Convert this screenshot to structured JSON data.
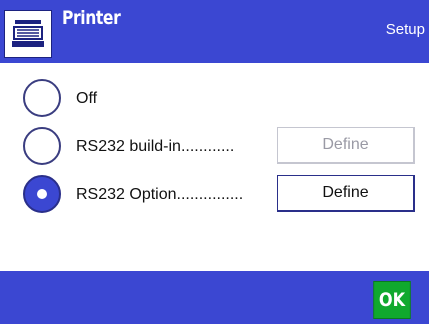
{
  "header": {
    "title": "Printer",
    "section": "Setup",
    "icon": "printer-icon"
  },
  "options": [
    {
      "label": "Off",
      "selected": false,
      "has_define": false
    },
    {
      "label": "RS232 build-in............",
      "selected": false,
      "has_define": true,
      "define_label": "Define",
      "define_enabled": false
    },
    {
      "label": "RS232 Option...............",
      "selected": true,
      "has_define": true,
      "define_label": "Define",
      "define_enabled": true
    }
  ],
  "footer": {
    "ok_label": "OK"
  },
  "colors": {
    "bar": "#3b47d2",
    "ok": "#10a92e",
    "text": "#111111",
    "disabled_text": "#9a9aa5"
  }
}
